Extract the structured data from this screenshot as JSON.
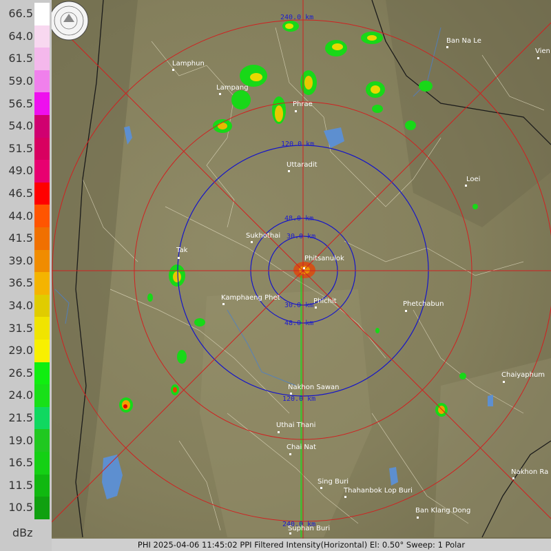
{
  "legend": {
    "unit": "dBz",
    "entries": [
      {
        "value": "66.5",
        "color": "#ffffff"
      },
      {
        "value": "64.0",
        "color": "#f8d8f0"
      },
      {
        "value": "61.5",
        "color": "#f4b8ec"
      },
      {
        "value": "59.0",
        "color": "#f080ec"
      },
      {
        "value": "56.5",
        "color": "#ee10ee"
      },
      {
        "value": "54.0",
        "color": "#d00070"
      },
      {
        "value": "51.5",
        "color": "#d80060"
      },
      {
        "value": "49.0",
        "color": "#e80070"
      },
      {
        "value": "46.5",
        "color": "#ff0000"
      },
      {
        "value": "44.0",
        "color": "#ff5500"
      },
      {
        "value": "41.5",
        "color": "#f07000"
      },
      {
        "value": "39.0",
        "color": "#f08c00"
      },
      {
        "value": "36.5",
        "color": "#f4b400"
      },
      {
        "value": "34.0",
        "color": "#e0cc00"
      },
      {
        "value": "31.5",
        "color": "#f0e400"
      },
      {
        "value": "29.0",
        "color": "#f8f000"
      },
      {
        "value": "26.5",
        "color": "#10ee10"
      },
      {
        "value": "24.0",
        "color": "#18e018"
      },
      {
        "value": "21.5",
        "color": "#10d860"
      },
      {
        "value": "19.0",
        "color": "#20c820"
      },
      {
        "value": "16.5",
        "color": "#14d014"
      },
      {
        "value": "11.5",
        "color": "#10b810"
      },
      {
        "value": "10.5",
        "color": "#10a010"
      }
    ]
  },
  "footer": "PHI 2025-04-06 11:45:02 PPI Filtered Intensity(Horizontal)  El: 0.50°  Sweep: 1 Polar",
  "rings": {
    "r30": "30.0 km",
    "r48": "48.0 km",
    "r120": "120.0 km",
    "r240": "240.0 km"
  },
  "cities": {
    "phitsanulok": "Phitsanulok",
    "lamphun": "Lamphun",
    "lampang": "Lampang",
    "phrae": "Phrae",
    "uttaradit": "Uttaradit",
    "sukhothai": "Sukhothai",
    "tak": "Tak",
    "kamphaeng_phet": "Kamphaeng Phet",
    "phichit": "Phichit",
    "phetchabun": "Phetchabun",
    "loei": "Loei",
    "ban_na_le": "Ban Na Le",
    "vientiane": "Vien",
    "nakhon_sawan": "Nakhon Sawan",
    "uthai_thani": "Uthai Thani",
    "chai_nat": "Chai Nat",
    "sing_buri": "Sing Buri",
    "thanabok_lop_buri": "Thahanbok Lop Buri",
    "ban_klang_dong": "Ban Klang Dong",
    "chaiyaphum": "Chaiyaphum",
    "nakhon_ra": "Nakhon Ra",
    "suphan_buri": "Suphan Buri"
  }
}
